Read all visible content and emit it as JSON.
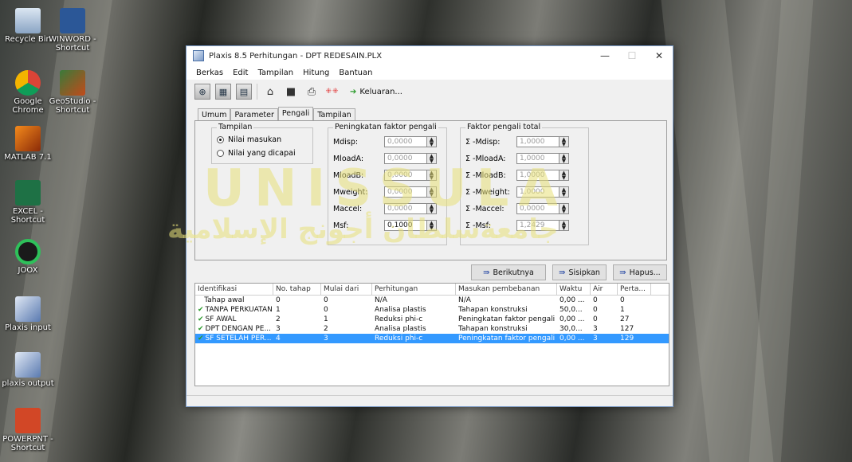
{
  "desktop": {
    "icons": [
      {
        "label": "Recycle Bin"
      },
      {
        "label": "WINWORD - Shortcut"
      },
      {
        "label": "Google Chrome"
      },
      {
        "label": "GeoStudio - Shortcut"
      },
      {
        "label": "MATLAB 7.1"
      },
      {
        "label": "EXCEL - Shortcut"
      },
      {
        "label": "JOOX"
      },
      {
        "label": "Plaxis input"
      },
      {
        "label": "plaxis output"
      },
      {
        "label": "POWERPNT - Shortcut"
      }
    ],
    "watermark": {
      "line1": "UNISSULA",
      "line2": "جامعةسلطان أجونج الإسلامية"
    }
  },
  "window": {
    "title": "Plaxis 8.5 Perhitungan - DPT REDESAIN.PLX",
    "controls": {
      "minimize": "—",
      "maximize": "☐",
      "close": "✕"
    },
    "menu": [
      "Berkas",
      "Edit",
      "Tampilan",
      "Hitung",
      "Bantuan"
    ],
    "toolbar": {
      "output_label": "Keluaran..."
    },
    "tabs": [
      "Umum",
      "Parameter",
      "Pengali",
      "Tampilan"
    ],
    "pengali": {
      "tampilan": {
        "title": "Tampilan",
        "option1": "Nilai masukan",
        "option2": "Nilai yang dicapai"
      },
      "peningkatan": {
        "title": "Peningkatan faktor pengali",
        "rows": [
          {
            "label": "Mdisp:",
            "value": "0,0000"
          },
          {
            "label": "MloadA:",
            "value": "0,0000"
          },
          {
            "label": "MloadB:",
            "value": "0,0000"
          },
          {
            "label": "Mweight:",
            "value": "0,0000"
          },
          {
            "label": "Maccel:",
            "value": "0,0000"
          },
          {
            "label": "Msf:",
            "value": "0,1000"
          }
        ]
      },
      "total": {
        "title": "Faktor pengali total",
        "rows": [
          {
            "label": "Σ -Mdisp:",
            "value": "1,0000"
          },
          {
            "label": "Σ -MloadA:",
            "value": "1,0000"
          },
          {
            "label": "Σ -MloadB:",
            "value": "1,0000"
          },
          {
            "label": "Σ -Mweight:",
            "value": "1,0000"
          },
          {
            "label": "Σ -Maccel:",
            "value": "0,0000"
          },
          {
            "label": "Σ -Msf:",
            "value": "1,2429"
          }
        ]
      }
    },
    "buttons": {
      "next": "Berikutnya",
      "insert": "Sisipkan",
      "delete": "Hapus..."
    },
    "table": {
      "headers": [
        "Identifikasi",
        "No. tahap",
        "Mulai dari",
        "Perhitungan",
        "Masukan pembebanan",
        "Waktu",
        "Air",
        "Perta..."
      ],
      "rows": [
        {
          "checked": false,
          "id": "Tahap awal",
          "no": "0",
          "from": "0",
          "calc": "N/A",
          "load": "N/A",
          "time": "0,00 ...",
          "water": "0",
          "step": "0"
        },
        {
          "checked": true,
          "id": "TANPA PERKUATAN",
          "no": "1",
          "from": "0",
          "calc": "Analisa plastis",
          "load": "Tahapan konstruksi",
          "time": "50,0...",
          "water": "0",
          "step": "1"
        },
        {
          "checked": true,
          "id": "SF AWAL",
          "no": "2",
          "from": "1",
          "calc": "Reduksi phi-c",
          "load": "Peningkatan faktor pengali",
          "time": "0,00 ...",
          "water": "0",
          "step": "27"
        },
        {
          "checked": true,
          "id": "DPT DENGAN PE...",
          "no": "3",
          "from": "2",
          "calc": "Analisa plastis",
          "load": "Tahapan konstruksi",
          "time": "30,0...",
          "water": "3",
          "step": "127"
        },
        {
          "checked": true,
          "id": "SF SETELAH PER...",
          "no": "4",
          "from": "3",
          "calc": "Reduksi phi-c",
          "load": "Peningkatan faktor pengali",
          "time": "0,00 ...",
          "water": "3",
          "step": "129"
        }
      ]
    }
  }
}
